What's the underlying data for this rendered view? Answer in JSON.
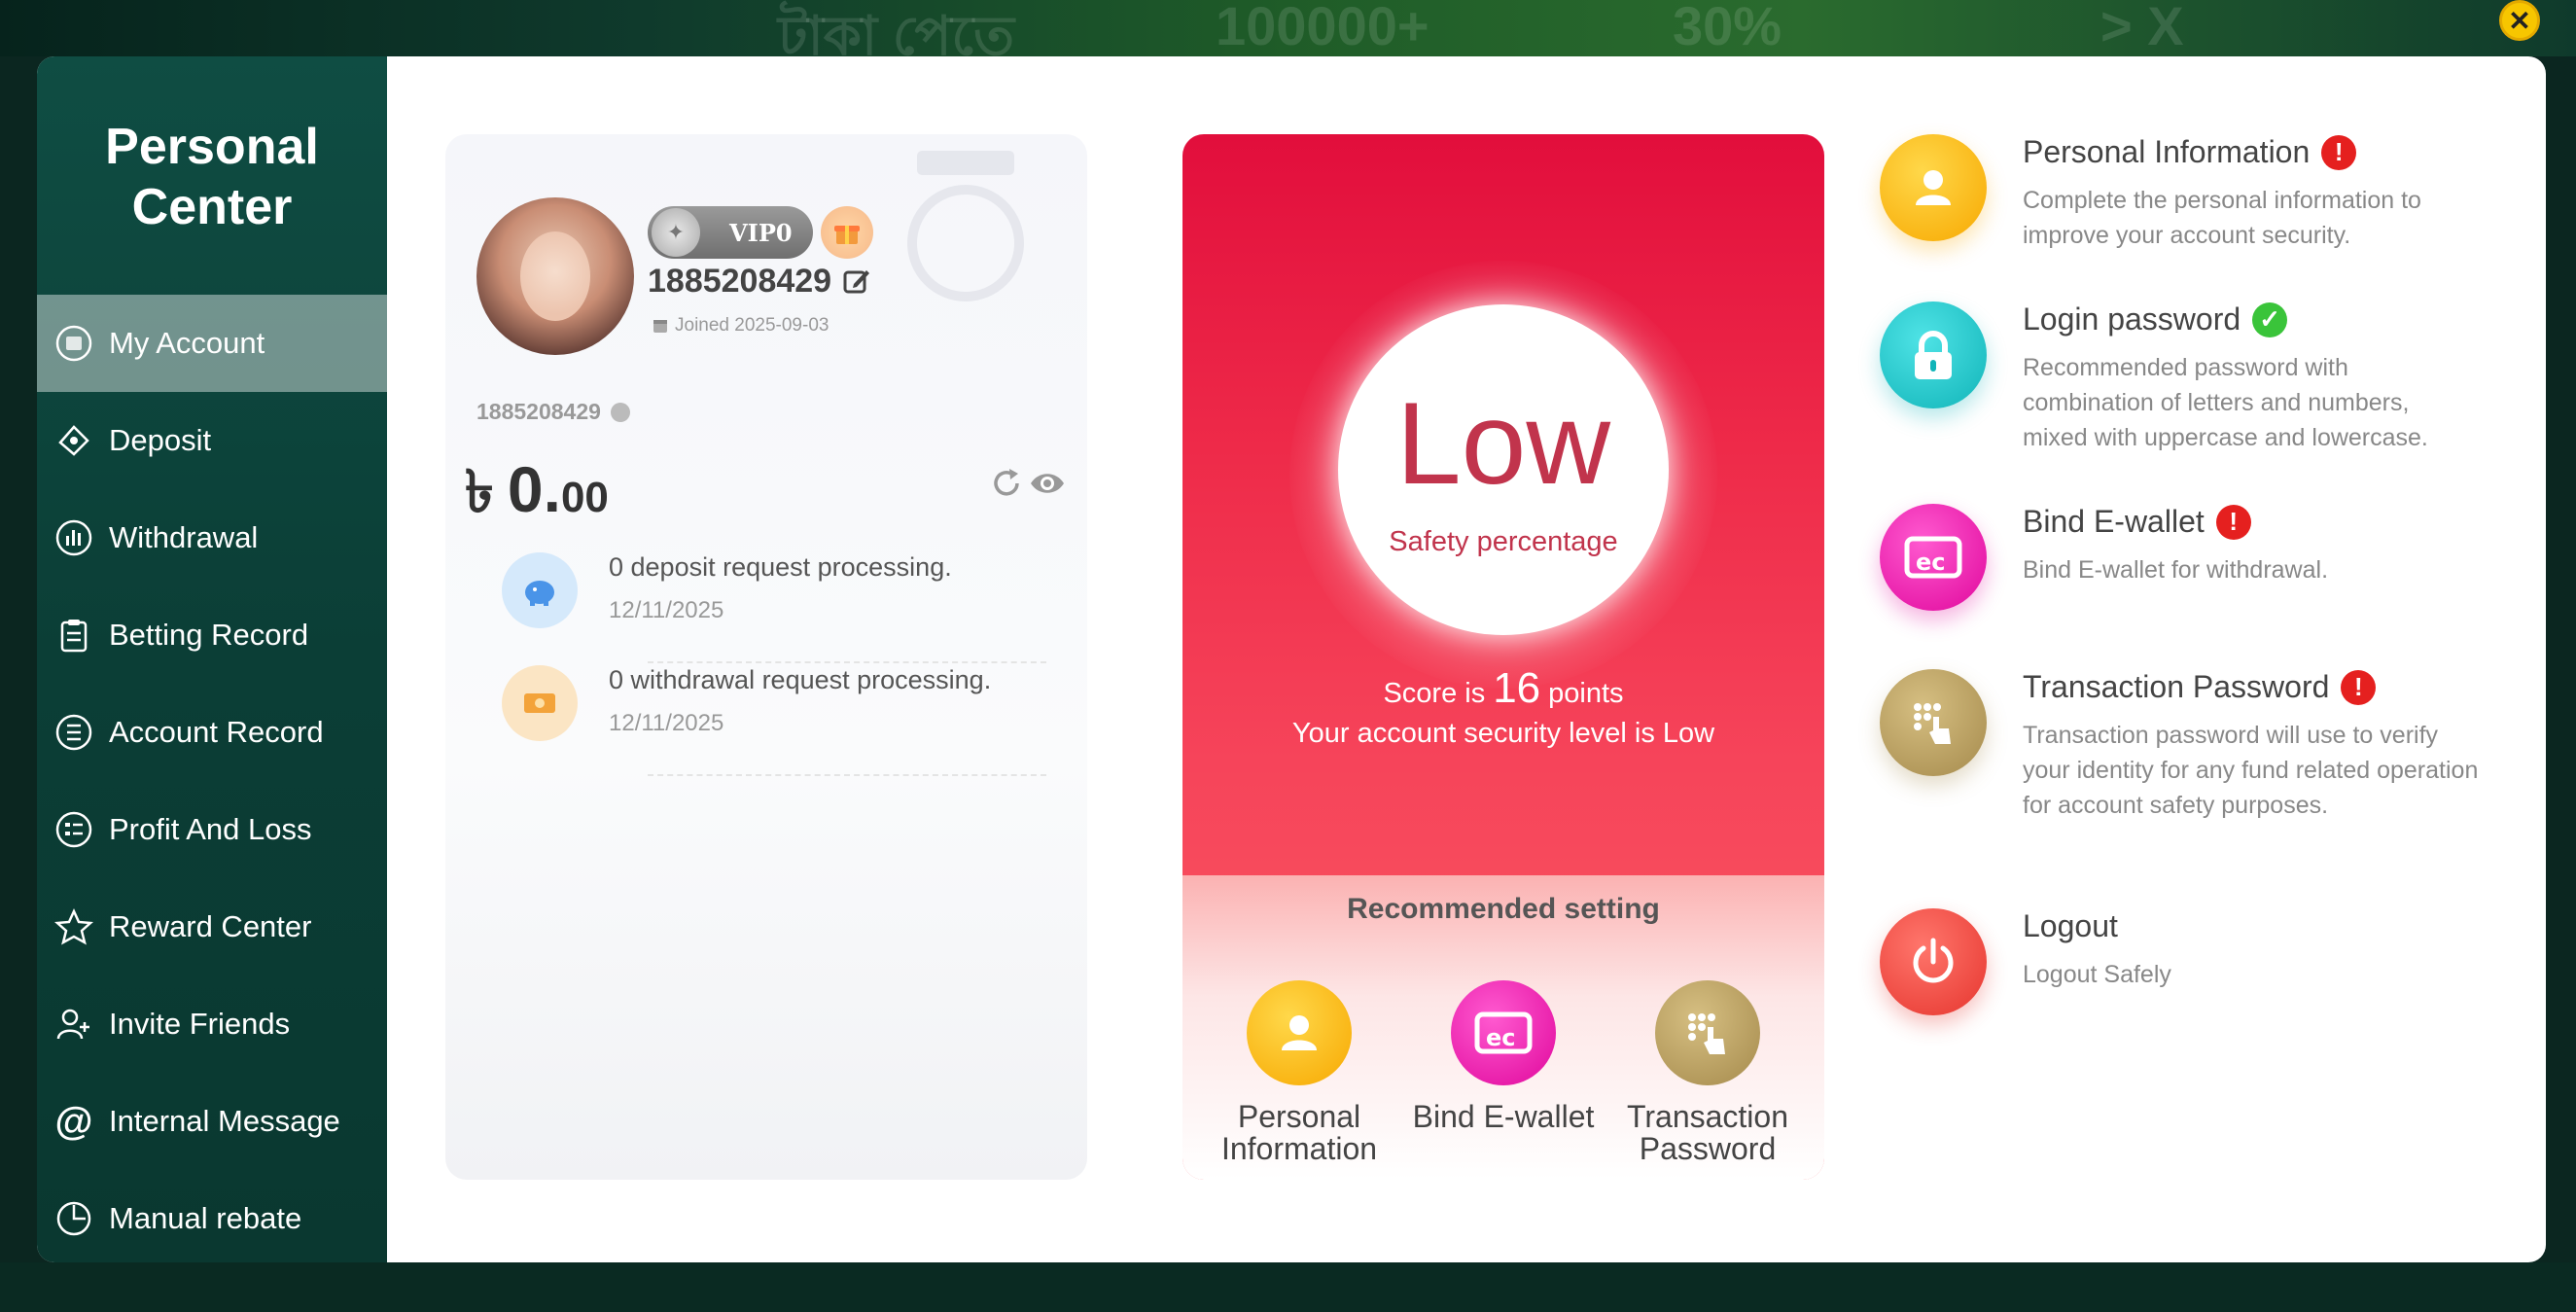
{
  "sidebar": {
    "title_line1": "Personal",
    "title_line2": "Center",
    "items": [
      {
        "label": "My Account"
      },
      {
        "label": "Deposit"
      },
      {
        "label": "Withdrawal"
      },
      {
        "label": "Betting Record"
      },
      {
        "label": "Account Record"
      },
      {
        "label": "Profit And Loss"
      },
      {
        "label": "Reward Center"
      },
      {
        "label": "Invite Friends"
      },
      {
        "label": "Internal Message"
      },
      {
        "label": "Manual rebate"
      }
    ],
    "active_item": "My Account"
  },
  "account": {
    "vip_label": "VIP0",
    "username": "1885208429",
    "joined": "Joined 2025-09-03",
    "uid": "1885208429",
    "balance": {
      "currency": "৳",
      "integer": "0.",
      "decimal": "00"
    },
    "requests": [
      {
        "text": "0 deposit request processing.",
        "date": "12/11/2025",
        "icon": "piggy-bank-icon"
      },
      {
        "text": "0 withdrawal request processing.",
        "date": "12/11/2025",
        "icon": "cash-icon"
      }
    ]
  },
  "security": {
    "level": "Low",
    "safety_label": "Safety percentage",
    "score_prefix": "Score is",
    "score": "16",
    "score_suffix": "points",
    "level_sentence": "Your account security level is Low",
    "recommended_title": "Recommended setting",
    "recommended": [
      {
        "label_line1": "Personal",
        "label_line2": "Information",
        "icon": "user-icon"
      },
      {
        "label_line1": "Bind E-wallet",
        "label_line2": "",
        "icon": "wallet-icon"
      },
      {
        "label_line1": "Transaction",
        "label_line2": "Password",
        "icon": "keypad-hand-icon"
      }
    ]
  },
  "settings": [
    {
      "title": "Personal Information",
      "status": "warning",
      "desc": "Complete the personal information to improve your account security."
    },
    {
      "title": "Login password",
      "status": "ok",
      "desc": "Recommended password with combination of letters and numbers, mixed with uppercase and lowercase."
    },
    {
      "title": "Bind E-wallet",
      "status": "warning",
      "desc": "Bind E-wallet for withdrawal."
    },
    {
      "title": "Transaction Password",
      "status": "warning",
      "desc": "Transaction password will use to verify your identity for any fund related operation for account safety purposes."
    },
    {
      "title": "Logout",
      "status": "",
      "desc": "Logout Safely"
    }
  ],
  "status_symbols": {
    "warning": "!",
    "ok": "✓"
  },
  "colors": {
    "sidebar": "#0f4d43",
    "security_red": "#e20e3c",
    "warning_red": "#e5201f",
    "ok_green": "#3ac43a",
    "yellow_icon": "#f7b500",
    "teal_icon": "#17c5c9",
    "magenta_icon": "#ee1ca9",
    "gold_icon": "#b59a5a",
    "logout_red": "#ef4b44"
  }
}
